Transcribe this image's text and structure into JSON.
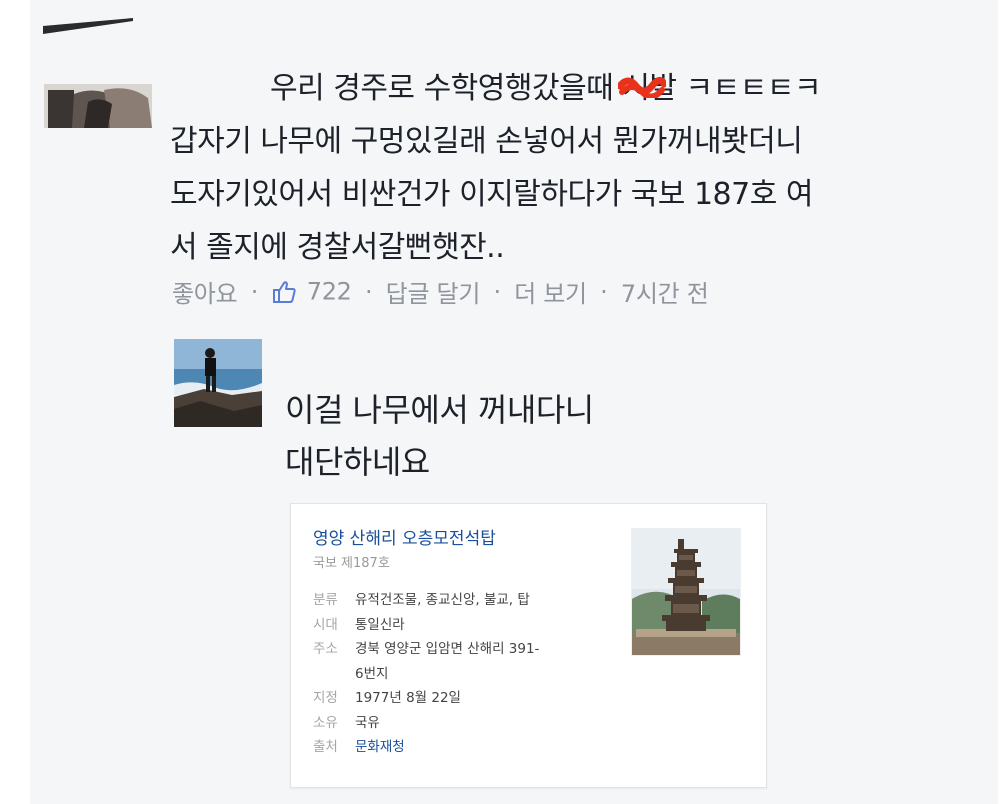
{
  "comment1": {
    "lines": [
      "우리 경주로 수학영행갔을때 시발 ㅋㅌㅌㅌㅋ",
      "갑자기 나무에 구멍있길래 손넣어서 뭔가꺼내봣더니",
      "도자기있어서 비싼건가 이지랄하다가 국보 187호 여",
      "서 졸지에 경찰서갈뻔햇잔.."
    ],
    "line1_prefix": "우리 경주로 수학영행갔을때 ",
    "line1_censored": "시발",
    "line1_suffix": " ㅋㅌㅌㅌㅋ",
    "actions": {
      "like": "좋아요",
      "like_count": "722",
      "reply": "답글 달기",
      "more": "더 보기",
      "time": "7시간 전",
      "separator": "·"
    }
  },
  "reply": {
    "lines": [
      "이걸 나무에서 꺼내다니",
      "대단하네요"
    ]
  },
  "card": {
    "title": "영양 산해리 오층모전석탑",
    "subtitle": "국보 제187호",
    "rows": [
      {
        "key": "분류",
        "value": "유적건조물, 종교신앙, 불교, 탑"
      },
      {
        "key": "시대",
        "value": "통일신라"
      },
      {
        "key": "주소",
        "value": "경북 영양군 입암면 산해리 391-"
      },
      {
        "key": "",
        "value": "6번지"
      },
      {
        "key": "지정",
        "value": "1977년 8월 22일"
      },
      {
        "key": "소유",
        "value": "국유"
      },
      {
        "key": "출처",
        "value": "문화재청"
      }
    ]
  },
  "colors": {
    "text": "#1d2129",
    "meta": "#90949c",
    "link": "#1a4f9c",
    "background": "#f5f6f8"
  }
}
